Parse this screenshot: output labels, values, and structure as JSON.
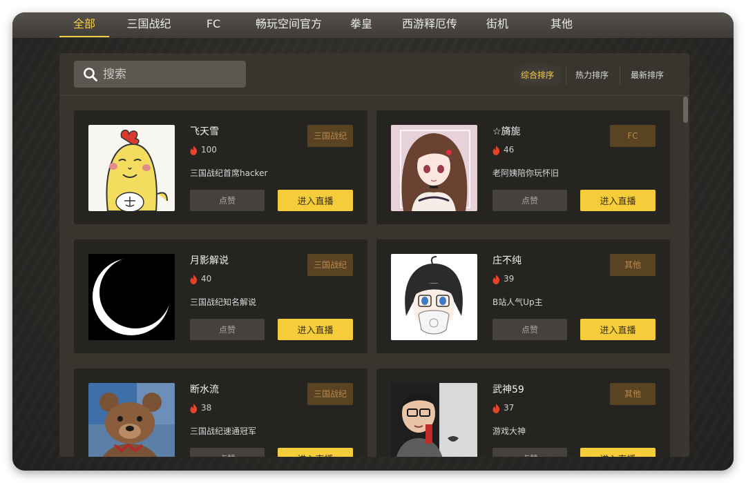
{
  "tabs": [
    {
      "label": "全部",
      "active": true
    },
    {
      "label": "三国战纪"
    },
    {
      "label": "FC"
    },
    {
      "label": "畅玩空间官方"
    },
    {
      "label": "拳皇"
    },
    {
      "label": "西游释厄传"
    },
    {
      "label": "街机"
    },
    {
      "label": "其他"
    }
  ],
  "search": {
    "placeholder": "搜索",
    "icon": "search-icon"
  },
  "sort": {
    "options": [
      "综合排序",
      "热力排序",
      "最新排序"
    ],
    "active": "综合排序"
  },
  "colors": {
    "accent": "#f5cc4a",
    "badge_bg": "#5a4322",
    "badge_text": "#b88a4d",
    "card_bg": "#262420",
    "panel_bg": "#38352f",
    "fire": "#e5432c"
  },
  "cards": [
    {
      "name": "飞天雪",
      "heat": "100",
      "desc": "三国战纪首席hacker",
      "tag": "三国战纪",
      "like_label": "点赞",
      "live_label": "进入直播"
    },
    {
      "name": "☆旖旎",
      "heat": "46",
      "desc": "老阿姨陪你玩怀旧",
      "tag": "FC",
      "like_label": "点赞",
      "live_label": "进入直播"
    },
    {
      "name": "月影解说",
      "heat": "40",
      "desc": "三国战纪知名解说",
      "tag": "三国战纪",
      "like_label": "点赞",
      "live_label": "进入直播"
    },
    {
      "name": "庄不纯",
      "heat": "39",
      "desc": "B站人气Up主",
      "tag": "其他",
      "like_label": "点赞",
      "live_label": "进入直播"
    },
    {
      "name": "断水流",
      "heat": "38",
      "desc": "三国战纪速通冠军",
      "tag": "三国战纪",
      "like_label": "点赞",
      "live_label": "进入直播"
    },
    {
      "name": "武神59",
      "heat": "37",
      "desc": "游戏大神",
      "tag": "其他",
      "like_label": "点赞",
      "live_label": "进入直播"
    }
  ]
}
